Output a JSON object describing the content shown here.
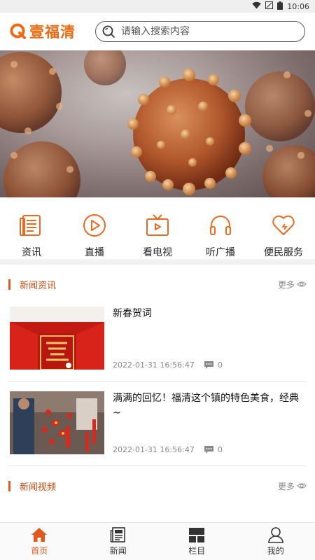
{
  "status_bar": {
    "time": "10:06"
  },
  "header": {
    "logo_text": "壹福清",
    "search_placeholder": "请输入搜索内容"
  },
  "quick_menu": [
    {
      "label": "资讯",
      "icon": "news-icon"
    },
    {
      "label": "直播",
      "icon": "play-icon"
    },
    {
      "label": "看电视",
      "icon": "tv-icon"
    },
    {
      "label": "听广播",
      "icon": "headphones-icon"
    },
    {
      "label": "便民服务",
      "icon": "heart-icon"
    }
  ],
  "sections": [
    {
      "title": "新闻资讯",
      "more_label": "更多",
      "items": [
        {
          "title": "新春贺词",
          "time": "2022-01-31 16:56:47",
          "comments": "0"
        },
        {
          "title": "满满的回忆！福清这个镇的特色美食，经典~",
          "time": "2022-01-31 16:56:47",
          "comments": "0"
        }
      ]
    },
    {
      "title": "新闻视频",
      "more_label": "更多"
    }
  ],
  "tab_bar": [
    {
      "label": "首页",
      "icon": "home-icon",
      "active": true
    },
    {
      "label": "新闻",
      "icon": "newspaper-icon",
      "active": false
    },
    {
      "label": "栏目",
      "icon": "grid-icon",
      "active": false
    },
    {
      "label": "我的",
      "icon": "user-icon",
      "active": false
    }
  ],
  "colors": {
    "accent": "#f06a12",
    "section_title": "#d24a12",
    "tab_active": "#e05a1c"
  }
}
